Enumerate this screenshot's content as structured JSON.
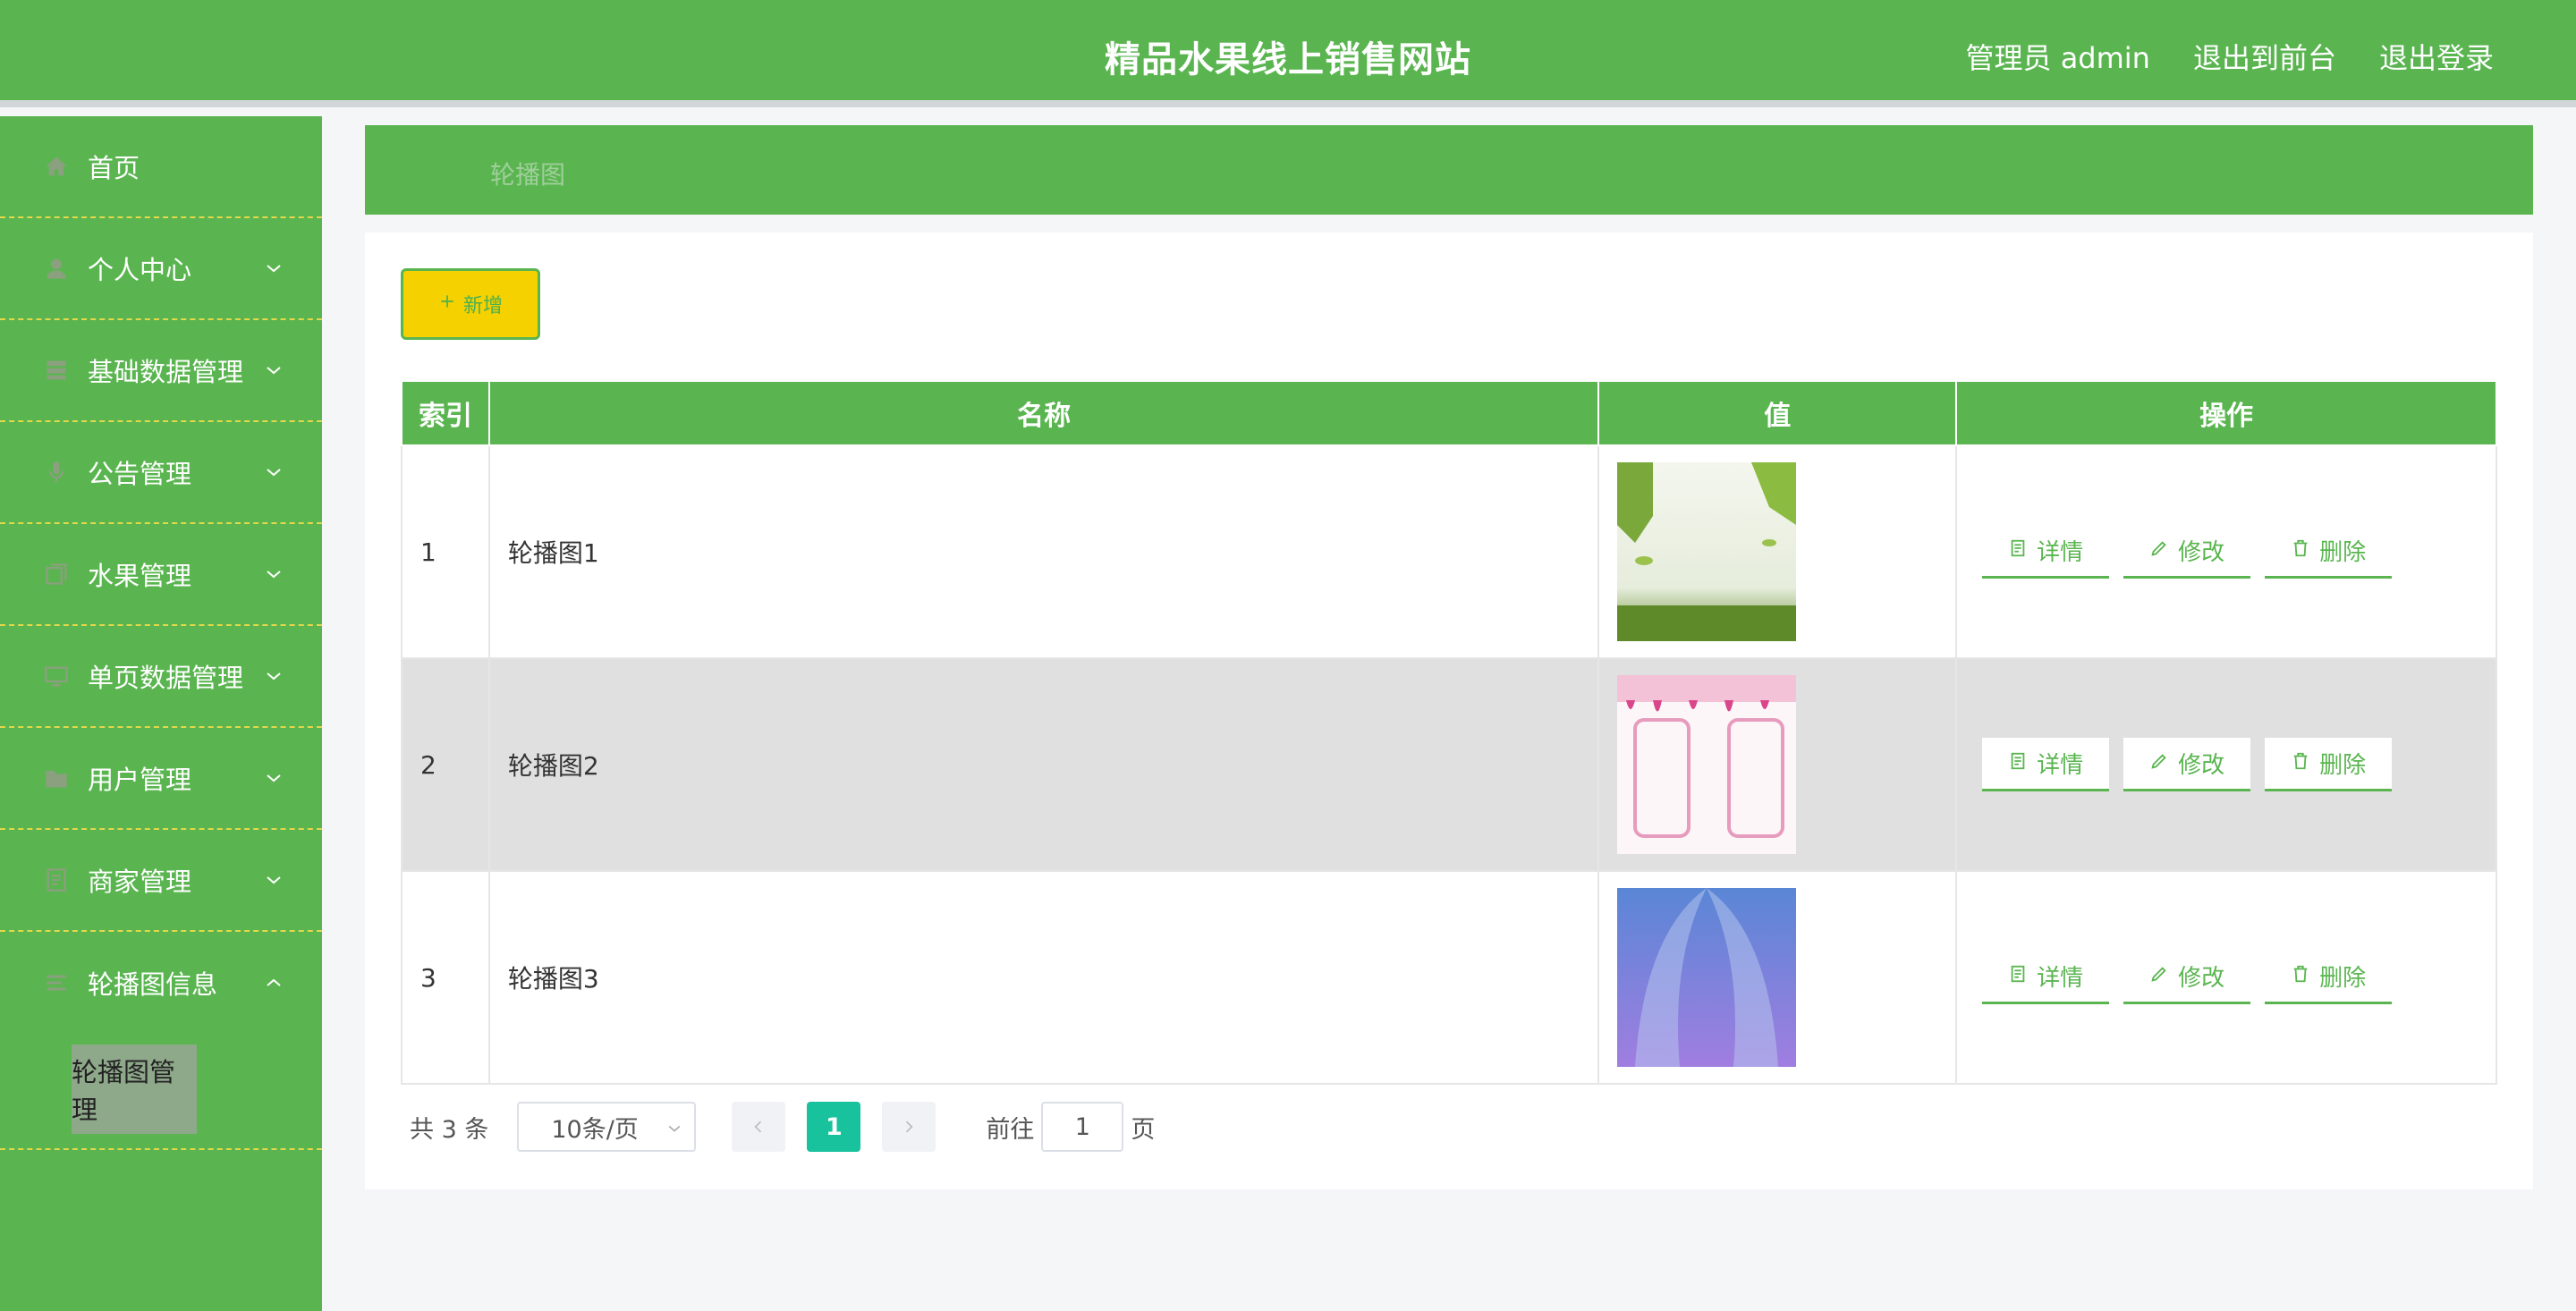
{
  "header": {
    "title": "精品水果线上销售网站",
    "admin_label": "管理员 admin",
    "front_label": "退出到前台",
    "logout_label": "退出登录",
    "accent_color": "#5ab550"
  },
  "sidebar": {
    "items": [
      {
        "label": "首页",
        "icon": "home-icon"
      },
      {
        "label": "个人中心",
        "icon": "user-icon"
      },
      {
        "label": "基础数据管理",
        "icon": "database-icon"
      },
      {
        "label": "公告管理",
        "icon": "microphone-icon"
      },
      {
        "label": "水果管理",
        "icon": "copy-icon"
      },
      {
        "label": "单页数据管理",
        "icon": "monitor-icon"
      },
      {
        "label": "用户管理",
        "icon": "folder-icon"
      },
      {
        "label": "商家管理",
        "icon": "document-icon"
      },
      {
        "label": "轮播图信息",
        "icon": "list-icon"
      }
    ],
    "submenu_label": "轮播图管理"
  },
  "breadcrumb": "轮播图",
  "toolbar": {
    "add_label": "新增"
  },
  "table": {
    "headers": [
      "索引",
      "名称",
      "值",
      "操作"
    ],
    "rows": [
      {
        "index": "1",
        "name": "轮播图1",
        "image": "green-leaves-image"
      },
      {
        "index": "2",
        "name": "轮播图2",
        "image": "pink-frames-image"
      },
      {
        "index": "3",
        "name": "轮播图3",
        "image": "purple-feathers-image"
      }
    ],
    "actions": {
      "detail": "详情",
      "edit": "修改",
      "delete": "删除"
    }
  },
  "pagination": {
    "total_label": "共 3 条",
    "page_size": "10条/页",
    "current_page": "1",
    "goto_label": "前往",
    "goto_value": "1",
    "page_suffix": "页"
  }
}
